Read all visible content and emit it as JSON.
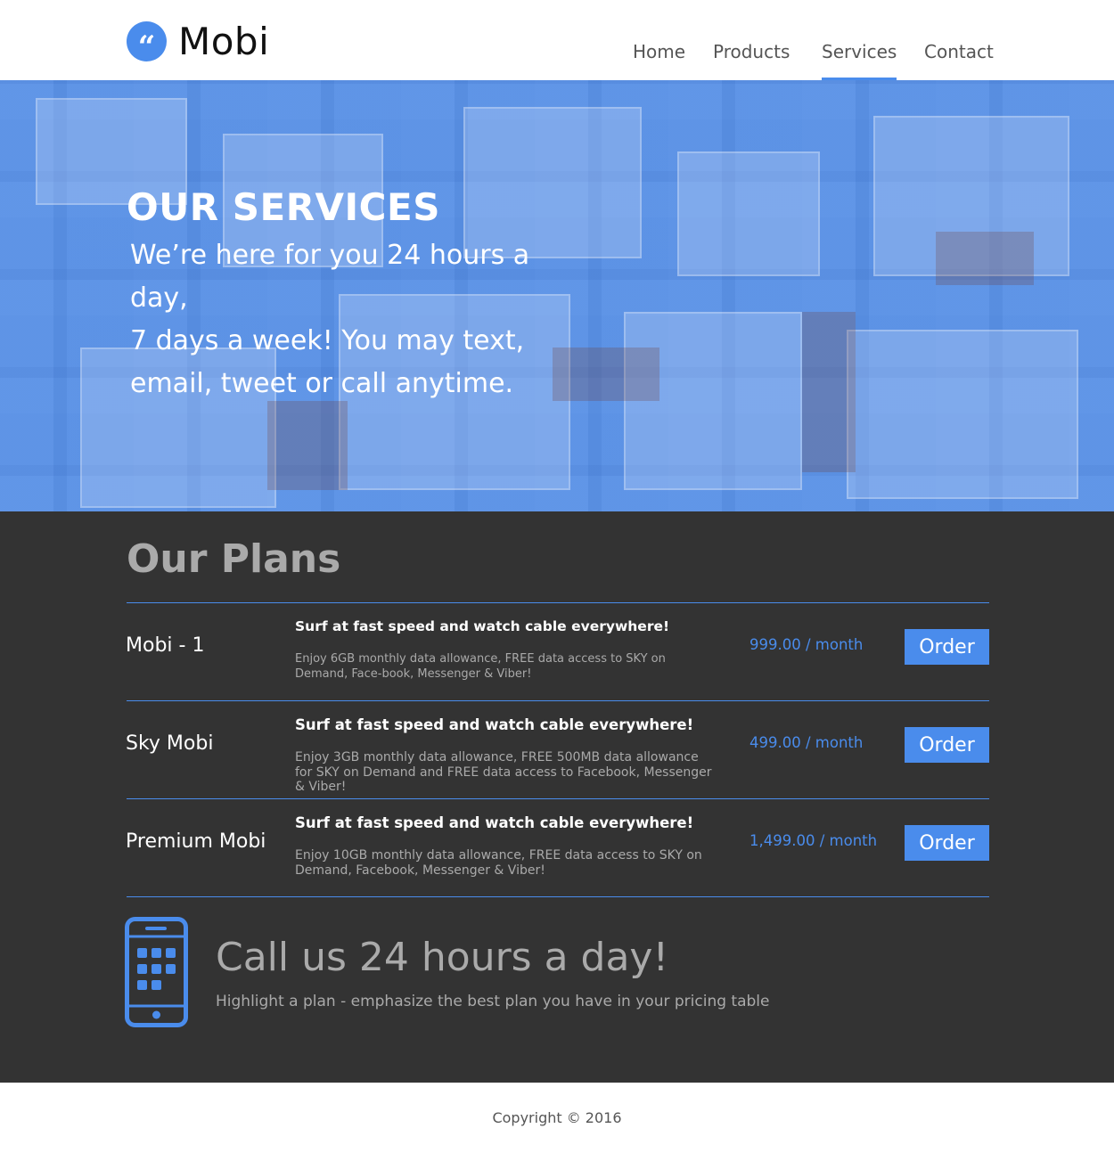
{
  "brand": {
    "name": "Mobi",
    "logo_icon": "quote-icon",
    "accent_color": "#4a8cec"
  },
  "nav": {
    "items": [
      {
        "label": "Home"
      },
      {
        "label": "Products"
      },
      {
        "label": "Services",
        "active": true
      },
      {
        "label": "Contact"
      }
    ]
  },
  "hero": {
    "title": "OUR SERVICES",
    "lines": [
      "We’re here for you 24 hours a day,",
      "7 days a week! You may text,",
      "email, tweet or call anytime."
    ]
  },
  "plans": {
    "title": "Our Plans",
    "items": [
      {
        "name": "Mobi - 1",
        "headline": "Surf at fast speed and watch cable everywhere!",
        "description": "Enjoy 6GB monthly data allowance, FREE data access to SKY on Demand, Face-book, Messenger & Viber!",
        "price": "999.00 / month",
        "order_label": "Order"
      },
      {
        "name": "Sky Mobi",
        "headline": "Surf at fast speed and watch cable everywhere!",
        "description": "Enjoy 3GB monthly data allowance, FREE 500MB data allowance for SKY on Demand and FREE data access to Facebook, Messenger & Viber!",
        "price": "499.00 / month",
        "order_label": "Order"
      },
      {
        "name": "Premium Mobi",
        "headline": "Surf at fast speed and watch cable everywhere!",
        "description": "Enjoy 10GB monthly data allowance, FREE data access to SKY on Demand, Facebook, Messenger & Viber!",
        "price": "1,499.00 / month",
        "order_label": "Order"
      }
    ]
  },
  "call": {
    "icon": "smartphone-icon",
    "title": "Call us 24 hours a day!",
    "subtitle": "Highlight a plan - emphasize the best plan you have in your pricing table"
  },
  "footer": {
    "copyright": "Copyright © 2016"
  }
}
